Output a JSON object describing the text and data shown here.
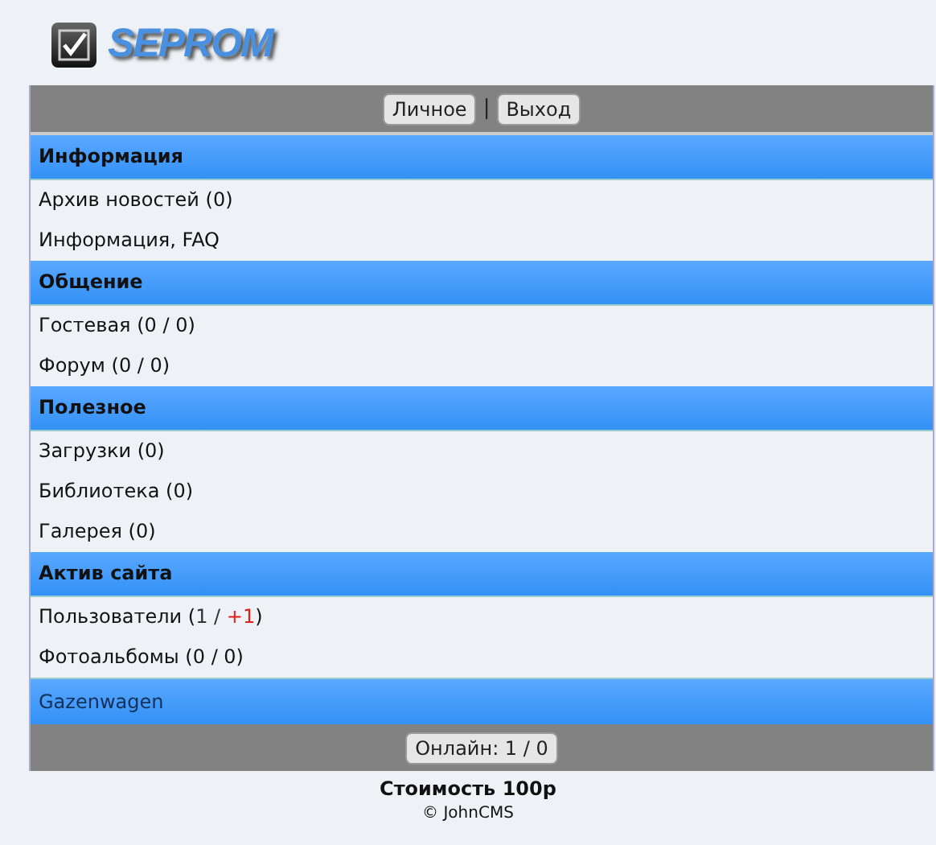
{
  "logo": {
    "text": "SEPROM"
  },
  "top_bar": {
    "buttons": [
      "Личное",
      "Выход"
    ],
    "separator": "|"
  },
  "sections": [
    {
      "title": "Информация",
      "items": [
        [
          {
            "text": "Архив новостей (0)",
            "kind": "normal"
          }
        ],
        [
          {
            "text": "Информация, FAQ",
            "kind": "normal"
          }
        ]
      ]
    },
    {
      "title": "Общение",
      "items": [
        [
          {
            "text": "Гостевая (0 / 0)",
            "kind": "normal"
          }
        ],
        [
          {
            "text": "Форум (0 / 0)",
            "kind": "normal"
          }
        ]
      ]
    },
    {
      "title": "Полезное",
      "items": [
        [
          {
            "text": "Загрузки (0)",
            "kind": "normal"
          }
        ],
        [
          {
            "text": "Библиотека (0)",
            "kind": "normal"
          }
        ],
        [
          {
            "text": "Галерея (0)",
            "kind": "normal"
          }
        ]
      ]
    },
    {
      "title": "Актив сайта",
      "items": [
        [
          {
            "text": "Пользователи (",
            "kind": "normal"
          },
          {
            "text": "1 / ",
            "kind": "count"
          },
          {
            "text": "+1",
            "kind": "alert"
          },
          {
            "text": ")",
            "kind": "normal"
          }
        ],
        [
          {
            "text": "Фотоальбомы (0 / 0)",
            "kind": "normal"
          }
        ]
      ]
    }
  ],
  "user_bar": {
    "text": "Gazenwagen"
  },
  "bottom_bar": {
    "button": "Онлайн: 1 / 0"
  },
  "footer": {
    "price": "Стоимость 100р",
    "copyright": "© JohnCMS"
  }
}
